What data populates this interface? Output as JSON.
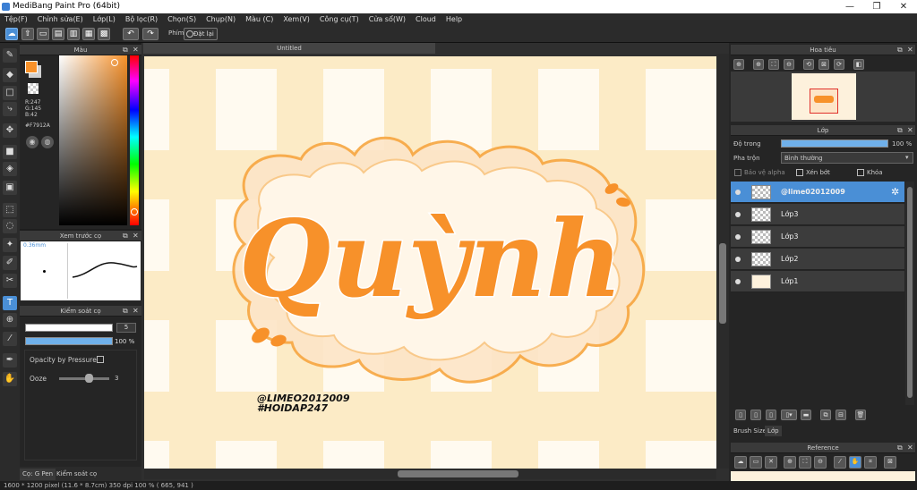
{
  "window": {
    "title": "MediBang Paint Pro (64bit)",
    "min": "—",
    "max": "❐",
    "close": "✕"
  },
  "menu": [
    "Tệp(F)",
    "Chỉnh sửa(E)",
    "Lớp(L)",
    "Bộ lọc(R)",
    "Chọn(S)",
    "Chụp(N)",
    "Màu (C)",
    "Xem(V)",
    "Công cụ(T)",
    "Cửa sổ(W)",
    "Cloud",
    "Help"
  ],
  "toolbar": {
    "phim_label": "Phím",
    "reset_label": "Đặt lại"
  },
  "colors": {
    "accent": "#4a8fd6",
    "current": "#f7912a",
    "secondary": "#d0d0d0"
  },
  "color_panel": {
    "title": "Màu",
    "r": "R:247",
    "g": "G:145",
    "b": "B:42",
    "hex": "#F7912A"
  },
  "brush_preview": {
    "title": "Xem trước cọ",
    "size": "0.36mm"
  },
  "brush_control": {
    "title": "Kiểm soát cọ",
    "size_value": "5",
    "opacity_value": "100 %",
    "opacity_pressure_label": "Opacity by Pressure",
    "ooze_label": "Ooze",
    "ooze_value": "3"
  },
  "bottom_tabs": {
    "brush_tab": "Cọ: G Pen",
    "control_tab": "Kiểm soát cọ"
  },
  "document": {
    "tab_title": "Untitled"
  },
  "artwork": {
    "main_text": "Quỳnh",
    "credit_1": "@LIMEO2012009",
    "credit_2": "#HOIDAP247"
  },
  "navigator": {
    "title": "Hoa tiêu"
  },
  "layers_panel": {
    "title": "Lớp",
    "opacity_label": "Độ trong",
    "opacity_value": "100 %",
    "blend_label": "Pha trộn",
    "blend_value": "Bình thường",
    "protect_alpha": "Bảo vệ alpha",
    "clipping": "Xén bớt",
    "lock": "Khóa",
    "layers": [
      {
        "name": "@lime02012009",
        "selected": true
      },
      {
        "name": "Lớp3",
        "selected": false
      },
      {
        "name": "Lớp3",
        "selected": false
      },
      {
        "name": "Lớp2",
        "selected": false
      },
      {
        "name": "Lớp1",
        "selected": false
      }
    ],
    "tab_brush_size": "Brush Size",
    "tab_layer": "Lớp"
  },
  "reference": {
    "title": "Reference"
  },
  "status": "1600 * 1200 pixel   (11.6 * 8.7cm)   350 dpi   100 %   ( 665, 941 )"
}
